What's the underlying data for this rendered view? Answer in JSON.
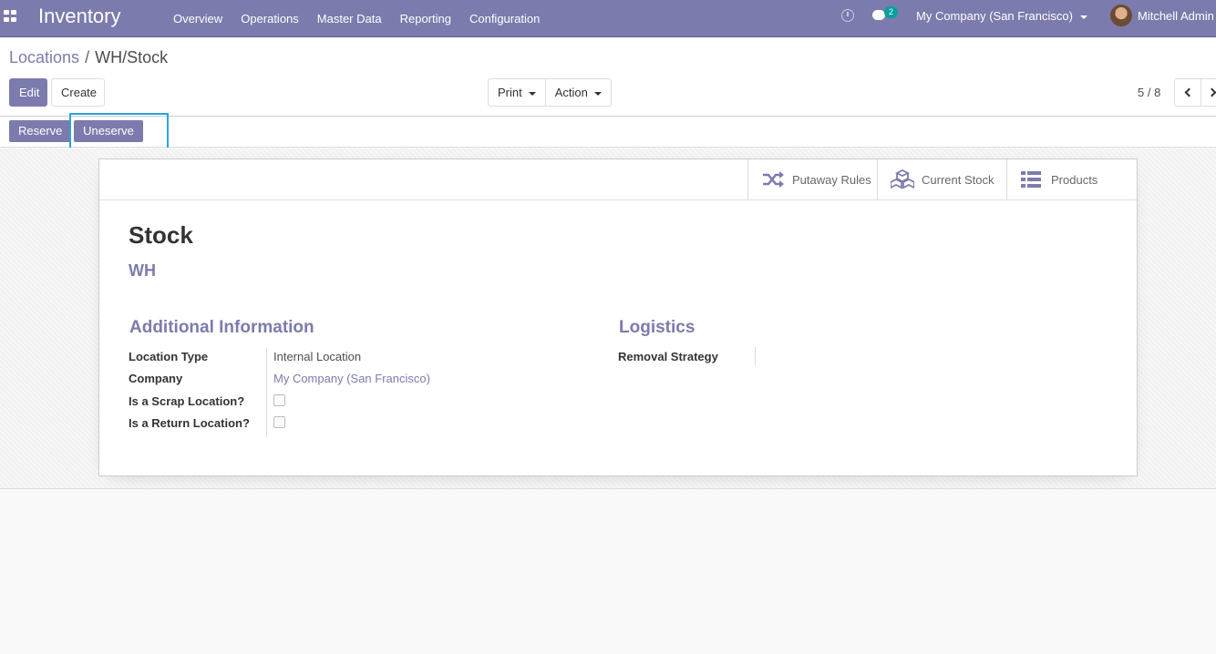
{
  "navbar": {
    "app_title": "Inventory",
    "menu": [
      "Overview",
      "Operations",
      "Master Data",
      "Reporting",
      "Configuration"
    ],
    "messages_count": "2",
    "company": "My Company (San Francisco)",
    "user": "Mitchell Admin"
  },
  "breadcrumb": {
    "parent": "Locations",
    "separator": "/",
    "current": "WH/Stock"
  },
  "buttons": {
    "edit": "Edit",
    "create": "Create",
    "print": "Print",
    "action": "Action"
  },
  "pager": {
    "value": "5 / 8"
  },
  "statusbar": {
    "reserve": "Reserve",
    "unreserve": "Uneserve"
  },
  "smart_buttons": {
    "putaway": "Putaway Rules",
    "current_stock": "Current Stock",
    "products": "Products"
  },
  "record": {
    "name": "Stock",
    "parent": "WH"
  },
  "additional_info": {
    "title": "Additional Information",
    "location_type_label": "Location Type",
    "location_type_value": "Internal Location",
    "company_label": "Company",
    "company_value": "My Company (San Francisco)",
    "scrap_label": "Is a Scrap Location?",
    "scrap_checked": false,
    "return_label": "Is a Return Location?",
    "return_checked": false
  },
  "logistics": {
    "title": "Logistics",
    "removal_label": "Removal Strategy",
    "removal_value": ""
  },
  "colors": {
    "brand": "#7c7bad",
    "badge": "#00a09d",
    "focus": "#29a3df"
  }
}
